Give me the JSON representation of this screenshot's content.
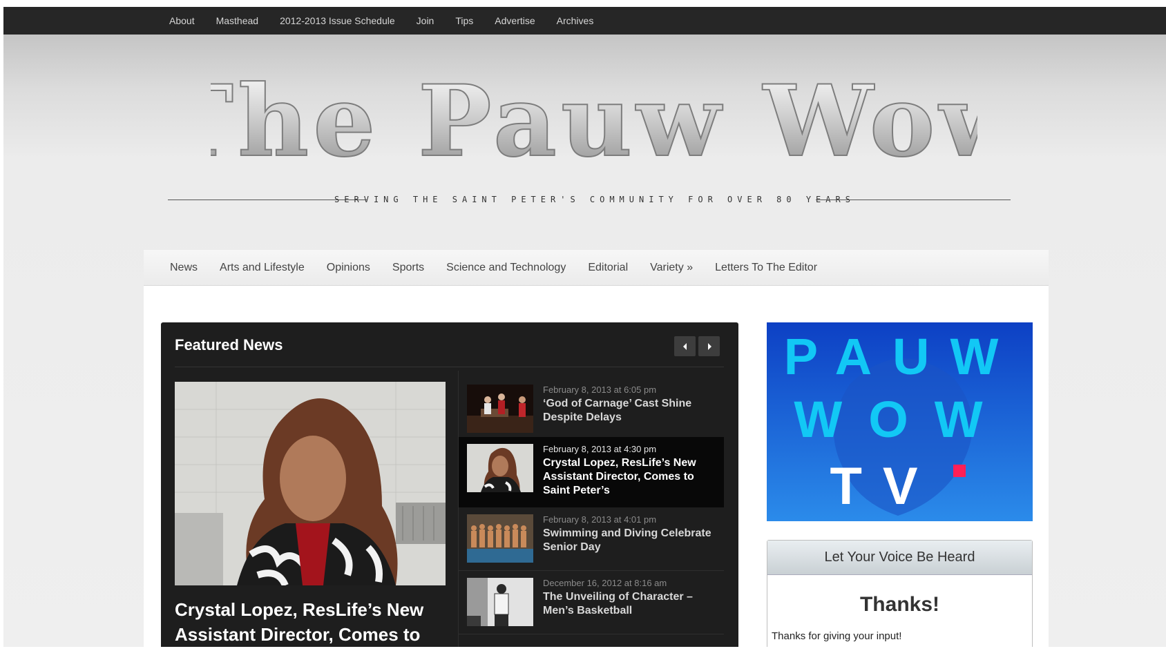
{
  "top_nav": [
    "About",
    "Masthead",
    "2012-2013 Issue Schedule",
    "Join",
    "Tips",
    "Advertise",
    "Archives"
  ],
  "masthead": {
    "logo_text": "The Pauw Wow",
    "tagline": "SERVING THE SAINT PETER'S COMMUNITY FOR OVER 80 YEARS"
  },
  "category_nav": [
    "News",
    "Arts and Lifestyle",
    "Opinions",
    "Sports",
    "Science and Technology",
    "Editorial",
    "Variety »",
    "Letters To The Editor"
  ],
  "featured": {
    "title": "Featured News",
    "main_headline": "Crystal Lopez, ResLife’s New Assistant Director, Comes to Saint Peter’s",
    "items": [
      {
        "date": "February 8, 2013 at 6:05 pm",
        "headline": "‘God of Carnage’ Cast Shine Despite Delays"
      },
      {
        "date": "February 8, 2013 at 4:30 pm",
        "headline": "Crystal Lopez, ResLife’s New Assistant Director, Comes to Saint Peter’s"
      },
      {
        "date": "February 8, 2013 at 4:01 pm",
        "headline": "Swimming and Diving Celebrate Senior Day"
      },
      {
        "date": "December 16, 2012 at 8:16 am",
        "headline": "The Unveiling of Character – Men’s Basketball"
      }
    ]
  },
  "sidebar": {
    "tv_lines": [
      "PAUW",
      "WOW",
      "TV"
    ],
    "voice": {
      "title": "Let Your Voice Be Heard",
      "thanks": "Thanks!",
      "message": "Thanks for giving your input!"
    }
  },
  "colors": {
    "topbar": "#262626",
    "featured_bg": "#1e1e1e",
    "tv_blue": "#1a63d6",
    "tv_cyan": "#12c8f5",
    "tv_pink": "#ff1f57"
  }
}
